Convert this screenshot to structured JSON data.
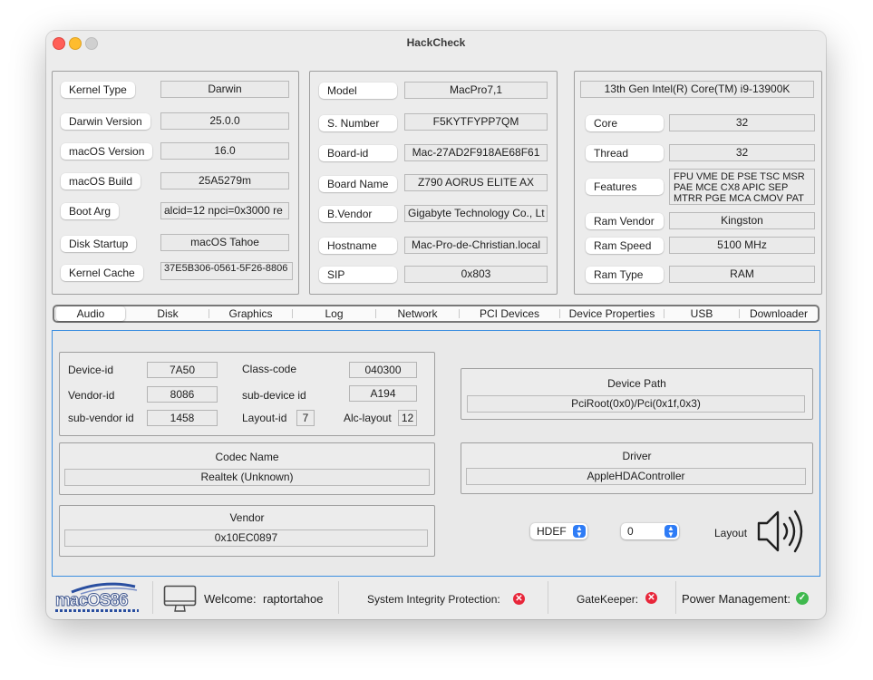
{
  "window": {
    "title": "HackCheck"
  },
  "system_panel": [
    {
      "label": "Kernel Type",
      "value": "Darwin"
    },
    {
      "label": "Darwin Version",
      "value": "25.0.0"
    },
    {
      "label": "macOS Version",
      "value": "16.0"
    },
    {
      "label": "macOS Build",
      "value": "25A5279m"
    },
    {
      "label": "Boot Arg",
      "value": "alcid=12 npci=0x3000 re"
    },
    {
      "label": "Disk Startup",
      "value": "macOS Tahoe"
    },
    {
      "label": "Kernel Cache",
      "value": "37E5B306-0561-5F26-8806"
    }
  ],
  "model_panel": [
    {
      "label": "Model",
      "value": "MacPro7,1"
    },
    {
      "label": "S. Number",
      "value": "F5KYTFYPP7QM"
    },
    {
      "label": "Board-id",
      "value": "Mac-27AD2F918AE68F61"
    },
    {
      "label": "Board Name",
      "value": "Z790 AORUS ELITE AX"
    },
    {
      "label": "B.Vendor",
      "value": "Gigabyte Technology Co., Lt"
    },
    {
      "label": "Hostname",
      "value": "Mac-Pro-de-Christian.local"
    },
    {
      "label": "SIP",
      "value": "0x803"
    }
  ],
  "cpu_panel": {
    "cpu_name": "13th Gen Intel(R) Core(TM) i9-13900K",
    "rows": [
      {
        "label": "Core",
        "value": "32"
      },
      {
        "label": "Thread",
        "value": "32"
      },
      {
        "label": "Features",
        "value": "FPU VME DE PSE TSC MSR PAE MCE CX8 APIC SEP MTRR PGE MCA CMOV PAT"
      },
      {
        "label": "Ram Vendor",
        "value": "Kingston"
      },
      {
        "label": "Ram Speed",
        "value": "5100 MHz"
      },
      {
        "label": "Ram Type",
        "value": "RAM"
      }
    ]
  },
  "tabs": [
    "Audio",
    "Disk",
    "Graphics",
    "Log",
    "Network",
    "PCI Devices",
    "Device Properties",
    "USB",
    "Downloader"
  ],
  "selected_tab": "Audio",
  "audio": {
    "device_id_label": "Device-id",
    "device_id": "7A50",
    "vendor_id_label": "Vendor-id",
    "vendor_id": "8086",
    "sub_vendor_id_label": "sub-vendor id",
    "sub_vendor_id": "1458",
    "class_code_label": "Class-code",
    "class_code": "040300",
    "sub_device_id_label": "sub-device id",
    "sub_device_id": "A194",
    "layout_id_label": "Layout-id",
    "layout_id": "7",
    "alc_layout_label": "Alc-layout",
    "alc_layout": "12",
    "device_path_label": "Device Path",
    "device_path": "PciRoot(0x0)/Pci(0x1f,0x3)",
    "codec_name_label": "Codec Name",
    "codec_name": "Realtek (Unknown)",
    "driver_label": "Driver",
    "driver": "AppleHDAController",
    "vendor_label": "Vendor",
    "vendor": "0x10EC0897",
    "hdef_select": "HDEF",
    "layout_select": "0",
    "layout_label": "Layout"
  },
  "status": {
    "logo_text": "macOS86",
    "welcome_label": "Welcome:",
    "username": "raptortahoe",
    "sip_label": "System Integrity Protection:",
    "gatekeeper_label": "GateKeeper:",
    "power_label": "Power Management:"
  },
  "colors": {
    "accent": "#2e7cf6",
    "error": "#e8263a",
    "ok": "#3fb94e"
  },
  "icons": {
    "monitor": "monitor-icon",
    "speaker": "speaker-icon"
  }
}
